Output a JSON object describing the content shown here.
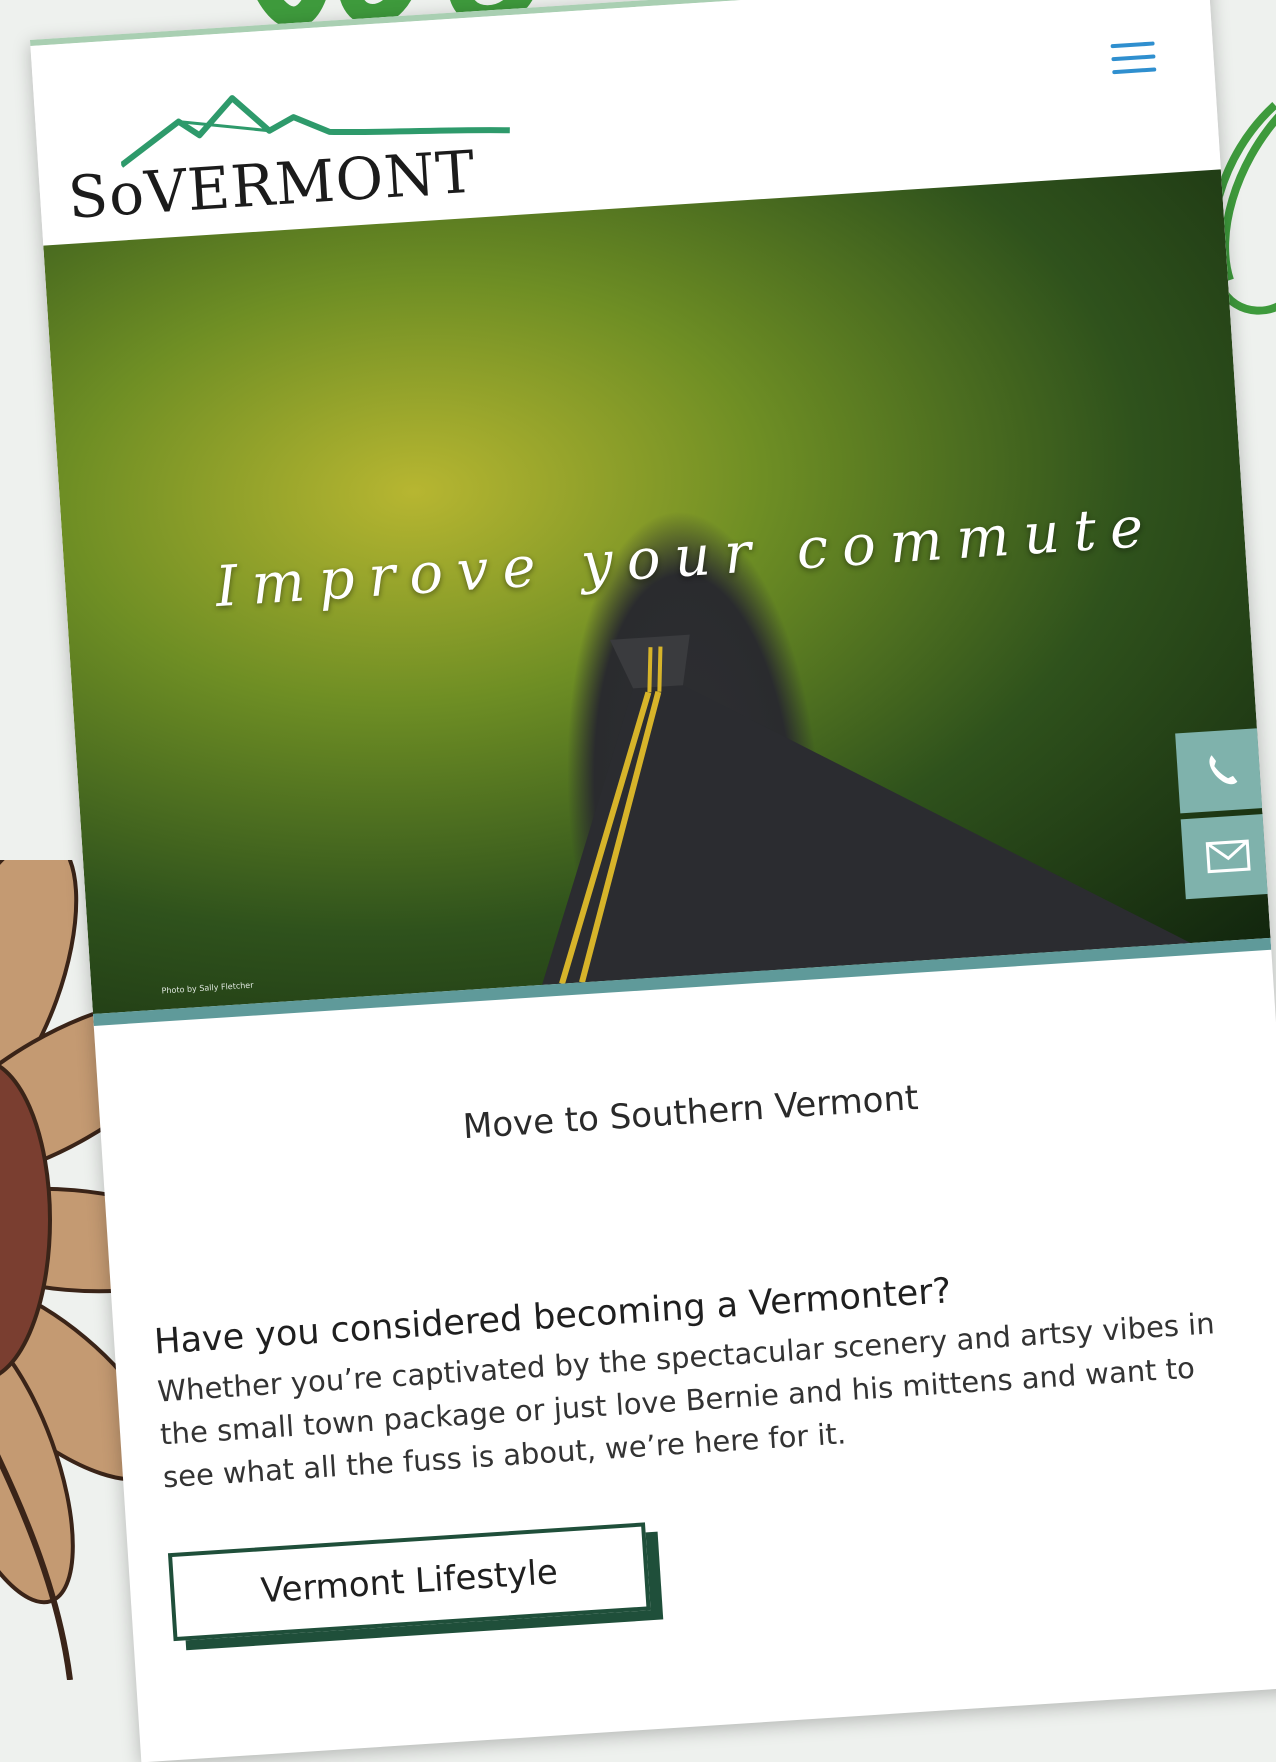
{
  "brand": {
    "logo_text": "SoVERMONT",
    "accent_green": "#2e9a6b",
    "menu_color": "#2f8fcf"
  },
  "hero": {
    "title": "Improve your commute",
    "photo_credit": "Photo by Sally Fletcher",
    "border_color": "#5f9a9a"
  },
  "contact": {
    "phone_icon": "phone-icon",
    "email_icon": "envelope-icon"
  },
  "main": {
    "section_title": "Move to Southern Vermont",
    "subhead": "Have you considered becoming a Vermonter?",
    "paragraph": "Whether you’re captivated by the spectacular scenery and artsy vibes in the small town package or just love Bernie and his mittens and want to see what all the fuss is about, we’re here for it.",
    "lifestyle_button": "Vermont Lifestyle"
  }
}
